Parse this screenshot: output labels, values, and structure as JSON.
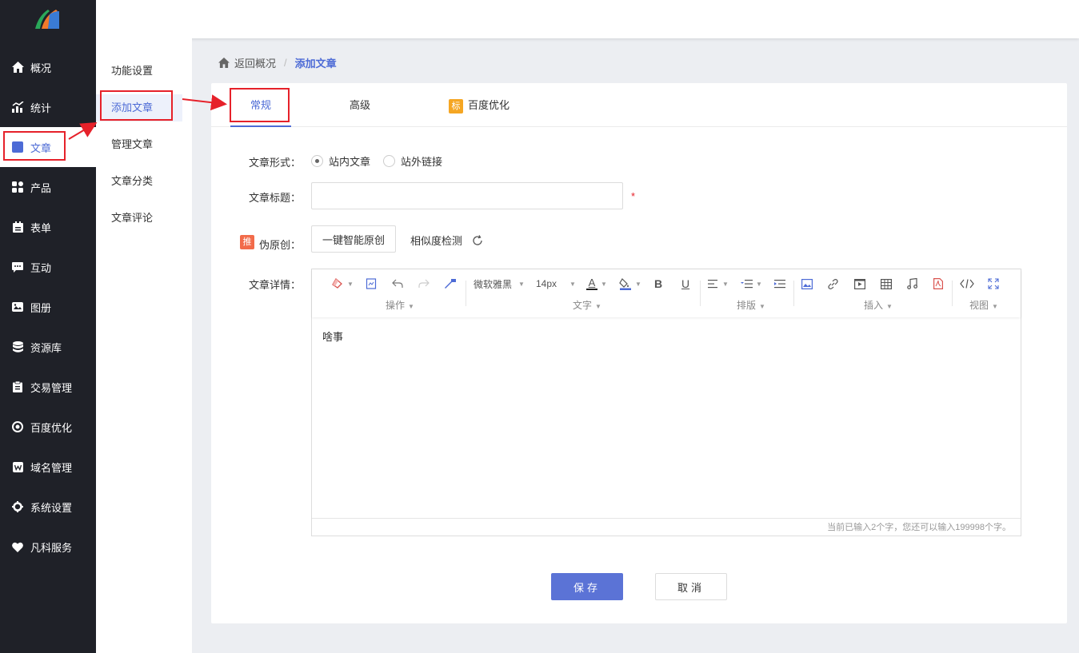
{
  "sidebar": {
    "items": [
      {
        "label": "概况",
        "icon": "home-icon"
      },
      {
        "label": "统计",
        "icon": "chart-icon"
      },
      {
        "label": "文章",
        "icon": "article-icon"
      },
      {
        "label": "产品",
        "icon": "grid-icon"
      },
      {
        "label": "表单",
        "icon": "form-icon"
      },
      {
        "label": "互动",
        "icon": "chat-icon"
      },
      {
        "label": "图册",
        "icon": "album-icon"
      },
      {
        "label": "资源库",
        "icon": "database-icon"
      },
      {
        "label": "交易管理",
        "icon": "clipboard-icon"
      },
      {
        "label": "百度优化",
        "icon": "target-icon"
      },
      {
        "label": "域名管理",
        "icon": "w-icon"
      },
      {
        "label": "系统设置",
        "icon": "gear-icon"
      },
      {
        "label": "凡科服务",
        "icon": "heart-icon"
      }
    ],
    "active_index": 2
  },
  "submenu": {
    "items": [
      "功能设置",
      "添加文章",
      "管理文章",
      "文章分类",
      "文章评论"
    ],
    "active_index": 1
  },
  "breadcrumb": {
    "back": "返回概况",
    "separator": "/",
    "current": "添加文章"
  },
  "tabs": {
    "general": "常规",
    "advanced": "高级",
    "baidu_badge": "标",
    "baidu": "百度优化"
  },
  "form": {
    "type_label": "文章形式：",
    "type_internal": "站内文章",
    "type_external": "站外链接",
    "title_label": "文章标题：",
    "title_value": "",
    "required_mark": "*",
    "pseudo_badge": "推",
    "pseudo_label": "伪原创：",
    "smart_button": "一键智能原创",
    "similarity_check": "相似度检测",
    "detail_label": "文章详情："
  },
  "editor": {
    "font_family": "微软雅黑",
    "font_size": "14px",
    "groups": {
      "operation": "操作",
      "text": "文字",
      "layout": "排版",
      "insert": "插入",
      "view": "视图"
    },
    "bold": "B",
    "underline": "U",
    "font_color_letter": "A",
    "content": "啥事",
    "footer": "当前已输入2个字，您还可以输入199998个字。"
  },
  "actions": {
    "save": "保存",
    "cancel": "取消"
  },
  "colors": {
    "accent": "#4d6bd6",
    "sidebar_bg": "#1f2128",
    "annotation_red": "#e6212a"
  }
}
